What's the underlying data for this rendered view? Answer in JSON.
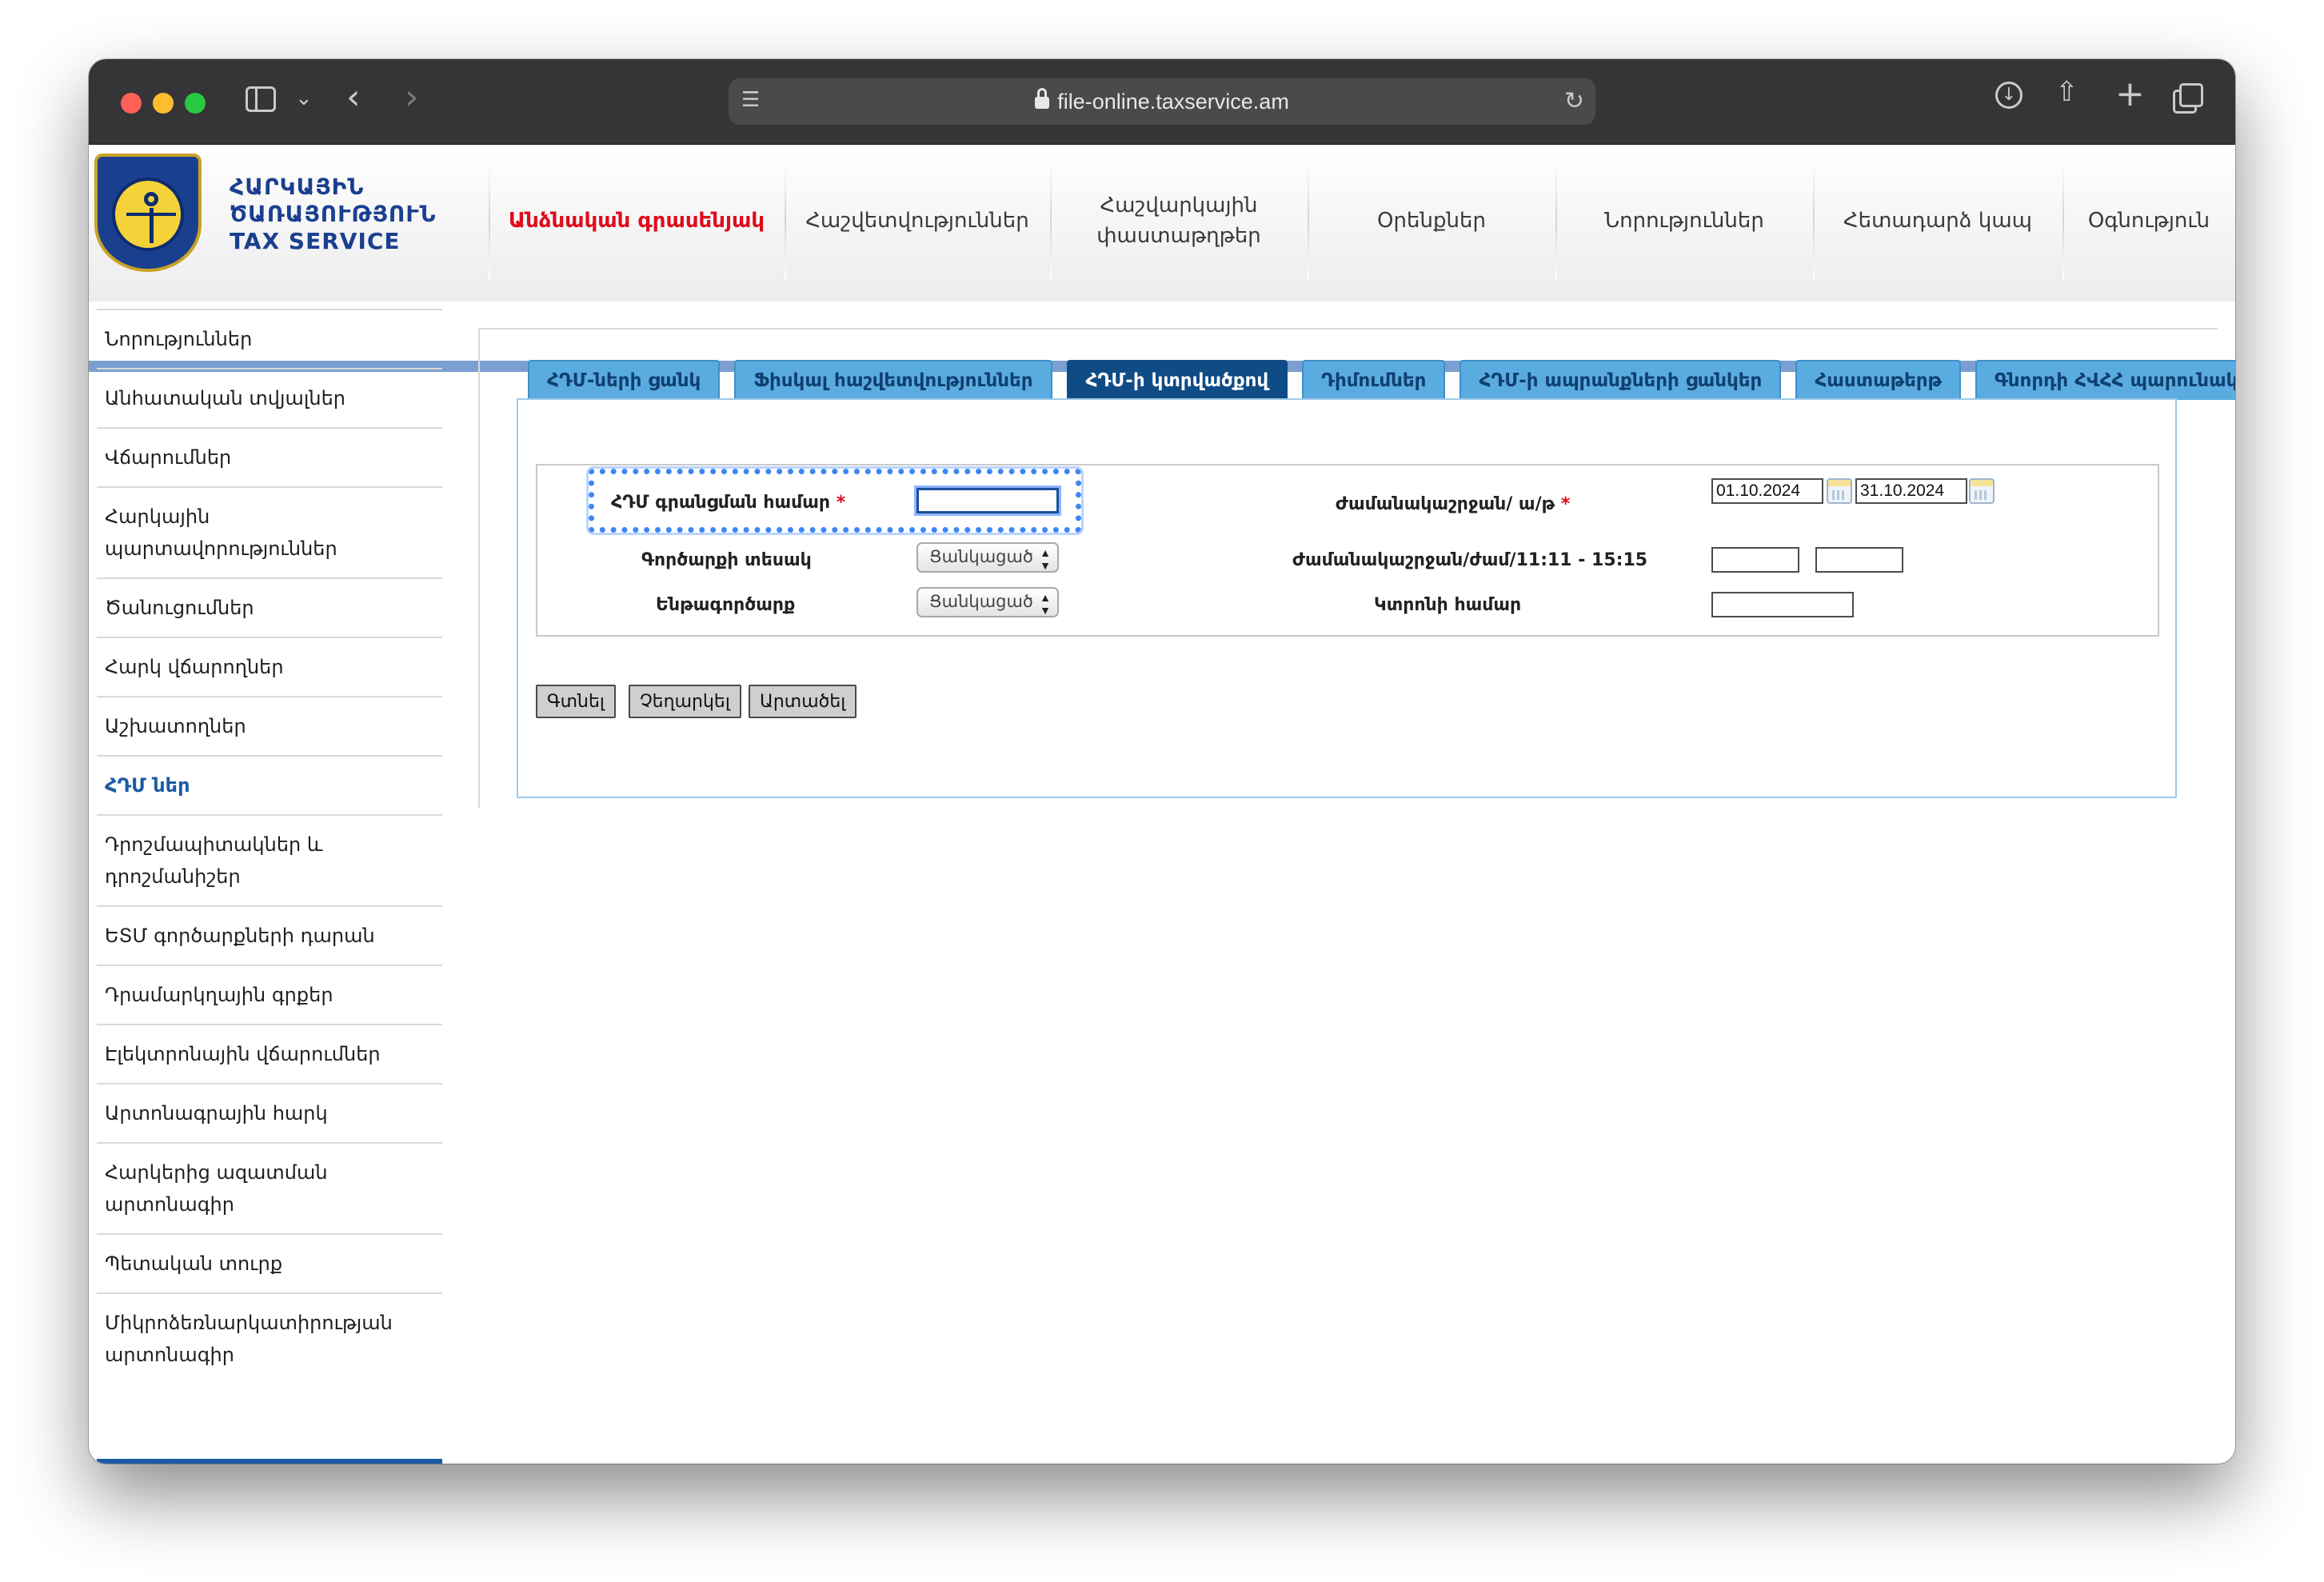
{
  "browser": {
    "url": "file-online.taxservice.am"
  },
  "site": {
    "logo_lines": [
      "ՀԱՐԿԱՅԻՆ",
      "ԾԱՌԱՅՈՒԹՅՈՒՆ",
      "TAX SERVICE"
    ],
    "nav": [
      "Անձնական գրասենյակ",
      "Հաշվետվություններ",
      "Հաշվարկային\nփաստաթղթեր",
      "Օրենքներ",
      "Նորություններ",
      "Հետադարձ կապ",
      "Օգնություն"
    ],
    "nav_active_index": 0
  },
  "sidebar": {
    "items": [
      "Նորություններ",
      "Անհատական տվյալներ",
      "Վճարումներ",
      "Հարկային\nպարտավորություններ",
      "Ծանուցումներ",
      "Հարկ վճարողներ",
      "Աշխատողներ",
      "ՀԴՄ ներ",
      "Դրոշմապիտակներ և\nդրոշմանիշեր",
      "ԵՏՄ գործարքների դարան",
      "Դրամարկղային գրքեր",
      "Էլեկտրոնային վճարումներ",
      "Արտոնագրային հարկ",
      "Հարկերից ազատման\nարտոնագիր",
      "Պետական տուրք",
      "Միկրոձեռնարկատիրության\nարտոնագիր"
    ],
    "active_index": 7
  },
  "tabs": [
    "ՀԴՄ-ների ցանկ",
    "Ֆիսկալ հաշվետվություններ",
    "ՀԴՄ-ի կտրվածքով",
    "Դիմումներ",
    "ՀԴՄ-ի ապրանքների ցանկեր",
    "Հաստաթերթ",
    "Գնորդի ՀՎՀՀ պարունակող կտրոններ"
  ],
  "active_tab_index": 2,
  "form": {
    "ecr_reg_label": "ՀԴՄ գրանցման համար",
    "ecr_reg_value": "",
    "period_label": "Ժամանակաշրջան/ ա/թ",
    "date_from": "01.10.2024",
    "date_to": "31.10.2024",
    "operation_type_label": "Գործարքի տեսակ",
    "operation_type_value": "Ցանկացած",
    "time_period_label": "Ժամանակաշրջան/ժամ/11:11 - 15:15",
    "time_from": "",
    "time_to": "",
    "suboperation_label": "Ենթագործարք",
    "suboperation_value": "Ցանկացած",
    "receipt_number_label": "Կտրոնի համար",
    "receipt_number_value": ""
  },
  "buttons": {
    "search": "Գտնել",
    "reset": "Չեղարկել",
    "export": "Արտածել"
  }
}
